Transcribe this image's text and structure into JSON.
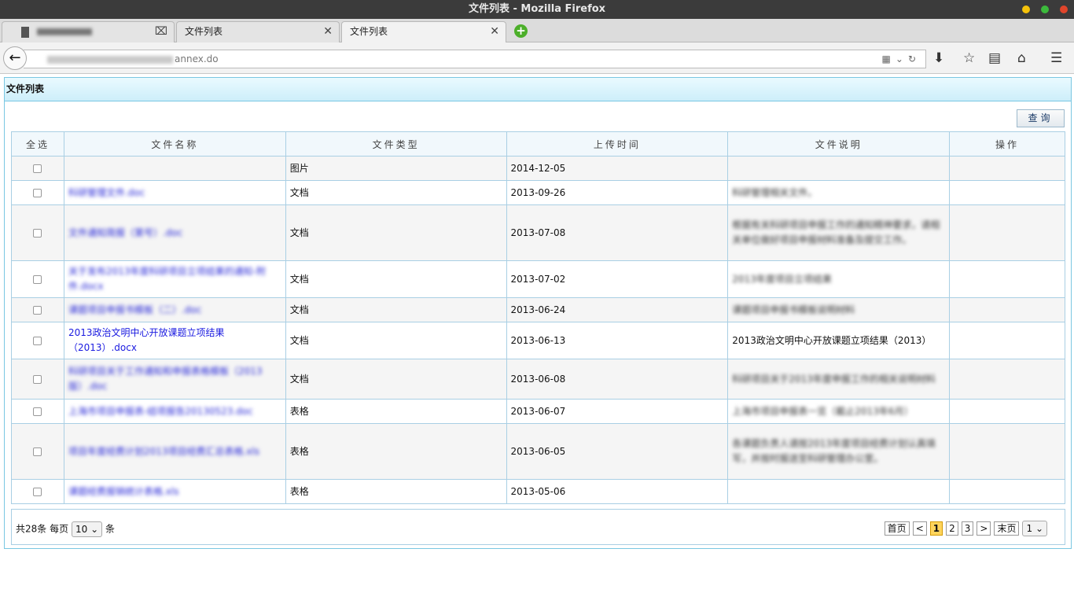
{
  "window": {
    "title": "文件列表 - Mozilla Firefox",
    "controls": [
      {
        "name": "minimize",
        "color": "#f5c20a"
      },
      {
        "name": "maximize",
        "color": "#3cba3c"
      },
      {
        "name": "close",
        "color": "#e0452b"
      }
    ]
  },
  "tabs": [
    {
      "label": "",
      "blurred": true
    },
    {
      "label": "文件列表"
    },
    {
      "label": "文件列表",
      "active": true
    }
  ],
  "address": {
    "url_visible_suffix": "annex.do"
  },
  "page": {
    "panel_title": "文件列表",
    "query_button": "查询"
  },
  "table": {
    "headers": [
      "全选",
      "文件名称",
      "文件类型",
      "上传时间",
      "文件说明",
      "操作"
    ],
    "rows": [
      {
        "name": "",
        "type": "图片",
        "date": "2014-12-05",
        "desc": "",
        "name_blurred": false,
        "desc_blurred": false
      },
      {
        "name": "科研管理文件.doc",
        "type": "文档",
        "date": "2013-09-26",
        "desc": "科研管理相关文件。",
        "name_blurred": true,
        "desc_blurred": true
      },
      {
        "name": "文件通知简报（第号）.doc",
        "type": "文档",
        "date": "2013-07-08",
        "desc": "根据有关科研项目申报工作的通知精神要求，请相关单位做好项目申报材料准备及提交工作。",
        "name_blurred": true,
        "desc_blurred": true
      },
      {
        "name": "关于发布2013年度科研项目立项结果的通知-附件.docx",
        "type": "文档",
        "date": "2013-07-02",
        "desc": "2013年度项目立项结果",
        "name_blurred": true,
        "desc_blurred": true
      },
      {
        "name": "课题项目申报书模板（二）.doc",
        "type": "文档",
        "date": "2013-06-24",
        "desc": "课题项目申报书模板说明材料",
        "name_blurred": true,
        "desc_blurred": true
      },
      {
        "name": "2013政治文明中心开放课题立项结果（2013）.docx",
        "type": "文档",
        "date": "2013-06-13",
        "desc": "2013政治文明中心开放课题立项结果（2013）",
        "name_blurred": false,
        "desc_blurred": false
      },
      {
        "name": "科研项目关于工作通知和申报表格模板（2013版）.doc",
        "type": "文档",
        "date": "2013-06-08",
        "desc": "科研项目关于2013年度申报工作的相关说明材料",
        "name_blurred": true,
        "desc_blurred": true
      },
      {
        "name": "上海市项目申报表-结项报告20130523.doc",
        "type": "表格",
        "date": "2013-06-07",
        "desc": "上海市项目申报表一览（截止2013年6月）",
        "name_blurred": true,
        "desc_blurred": true
      },
      {
        "name": "项目年度经费计划2013项目经费汇总表格.xls",
        "type": "表格",
        "date": "2013-06-05",
        "desc": "各课题负责人请按2013年度项目经费计划认真填写，并按时报送至科研管理办公室。",
        "name_blurred": true,
        "desc_blurred": true
      },
      {
        "name": "课题经费报销统计表格.xls",
        "type": "表格",
        "date": "2013-05-06",
        "desc": "",
        "name_blurred": true,
        "desc_blurred": false
      }
    ]
  },
  "pager": {
    "total_prefix": "共28条",
    "per_page_label": "每页",
    "per_page_value": "10",
    "per_page_suffix": "条",
    "first": "首页",
    "prev": "<",
    "pages": [
      "1",
      "2",
      "3"
    ],
    "current": "1",
    "next": ">",
    "last": "末页",
    "jump_value": "1"
  }
}
